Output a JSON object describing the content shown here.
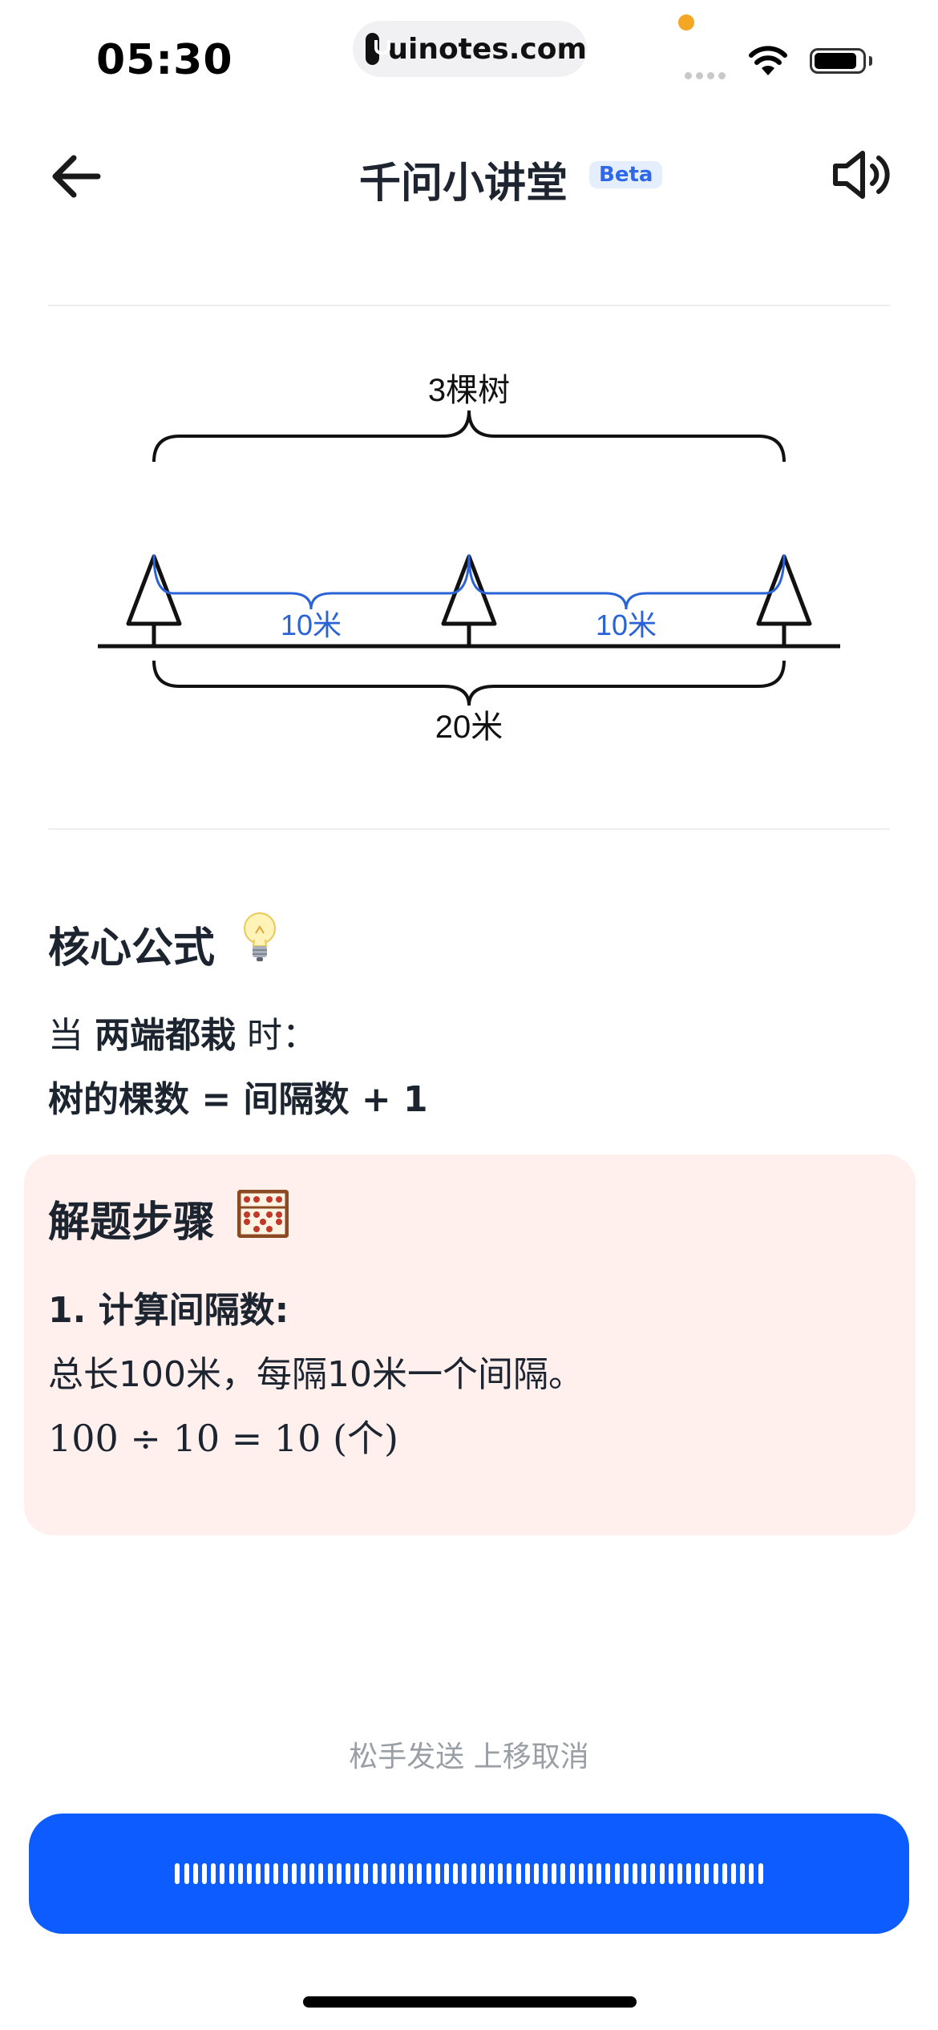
{
  "status_bar": {
    "time": "05:30",
    "url": "uinotes.com"
  },
  "header": {
    "title": "千问小讲堂",
    "badge": "Beta",
    "back_icon": "arrow-left-icon",
    "sound_icon": "speaker-icon"
  },
  "diagram": {
    "top_label": "3棵树",
    "gap_label_1": "10米",
    "gap_label_2": "10米",
    "bottom_label": "20米",
    "tree_count": 3,
    "accent_color": "#2a63d8"
  },
  "formula": {
    "title": "核心公式",
    "title_icon": "lightbulb-icon",
    "line1_prefix": "当 ",
    "line1_bold": "两端都栽",
    "line1_suffix": " 时：",
    "line2": "树的棵数 = 间隔数 + 1"
  },
  "steps": {
    "title": "解题步骤",
    "title_icon": "abacus-icon",
    "step1_head": "1. 计算间隔数:",
    "step1_desc": "总长100米，每隔10米一个间隔。",
    "step1_calc": "100 ÷ 10 = 10 (个)"
  },
  "voice": {
    "hint": "松手发送 上移取消",
    "button_color": "#0d5cff"
  }
}
